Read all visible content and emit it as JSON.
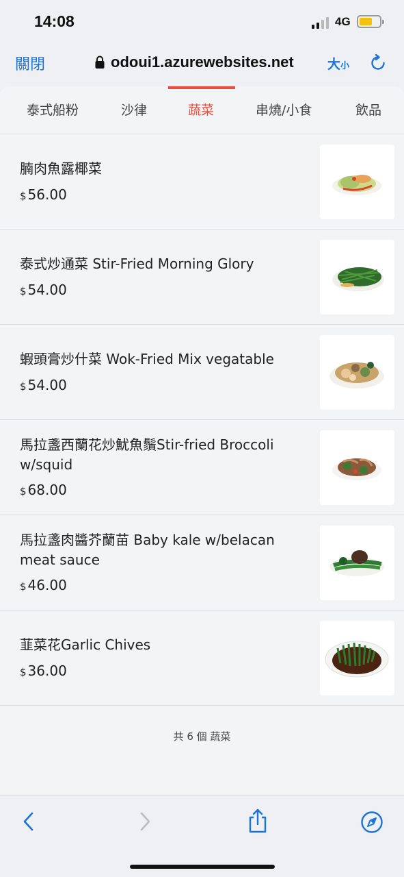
{
  "status": {
    "time": "14:08",
    "network": "4G"
  },
  "browser": {
    "close_label": "關閉",
    "url": "odoui1.azurewebsites.net",
    "text_size_big": "大",
    "text_size_small": "小"
  },
  "tabs": [
    {
      "label": "泰式船粉",
      "active": false
    },
    {
      "label": "沙律",
      "active": false
    },
    {
      "label": "蔬菜",
      "active": true
    },
    {
      "label": "串燒/小食",
      "active": false
    },
    {
      "label": "飲品",
      "active": false
    }
  ],
  "currency_symbol": "$",
  "items": [
    {
      "name": "腩肉魚露椰菜",
      "price": "56.00"
    },
    {
      "name": "泰式炒通菜 Stir-Fried Morning Glory",
      "price": "54.00"
    },
    {
      "name": "蝦頭膏炒什菜 Wok-Fried Mix vegatable",
      "price": "54.00"
    },
    {
      "name": "馬拉盞西蘭花炒魷魚鬚Stir-fried Broccoli w/squid",
      "price": "68.00"
    },
    {
      "name": "馬拉盞肉醬芥蘭苗 Baby kale w/belacan meat sauce",
      "price": "46.00"
    },
    {
      "name": "韮菜花Garlic Chives",
      "price": "36.00"
    }
  ],
  "summary": "共 6 個 蔬菜",
  "colors": {
    "accent": "#ee4b3c",
    "link": "#1a73d9",
    "background": "#f3f4f6"
  }
}
